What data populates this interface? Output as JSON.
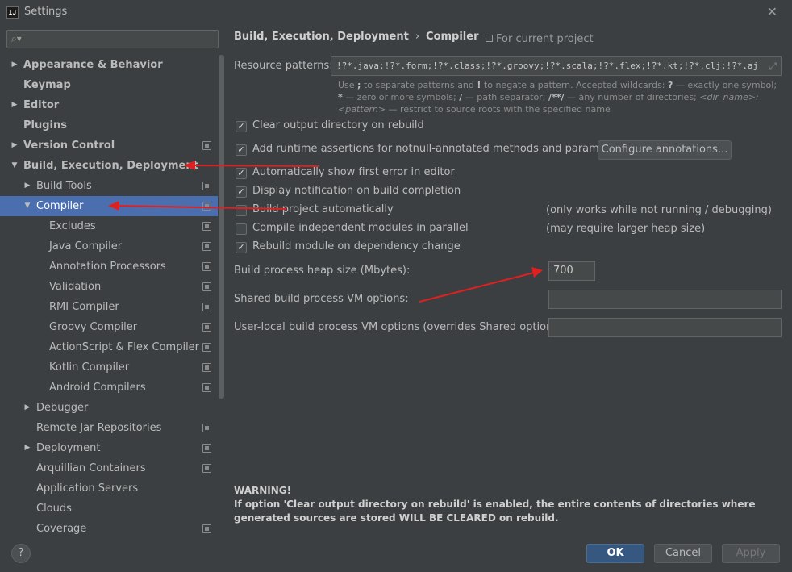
{
  "window": {
    "title": "Settings",
    "app_icon_text": "IJ"
  },
  "search": {
    "placeholder": ""
  },
  "sidebar": {
    "items": [
      {
        "label": "Appearance & Behavior",
        "level": 0,
        "arrow": "right",
        "bold": true,
        "project": false,
        "selected": false
      },
      {
        "label": "Keymap",
        "level": 0,
        "arrow": "none",
        "bold": true,
        "project": false,
        "selected": false
      },
      {
        "label": "Editor",
        "level": 0,
        "arrow": "right",
        "bold": true,
        "project": false,
        "selected": false
      },
      {
        "label": "Plugins",
        "level": 0,
        "arrow": "none",
        "bold": true,
        "project": false,
        "selected": false
      },
      {
        "label": "Version Control",
        "level": 0,
        "arrow": "right",
        "bold": true,
        "project": true,
        "selected": false
      },
      {
        "label": "Build, Execution, Deployment",
        "level": 0,
        "arrow": "down",
        "bold": true,
        "project": false,
        "selected": false
      },
      {
        "label": "Build Tools",
        "level": 1,
        "arrow": "right",
        "bold": false,
        "project": true,
        "selected": false
      },
      {
        "label": "Compiler",
        "level": 1,
        "arrow": "down",
        "bold": false,
        "project": true,
        "selected": true
      },
      {
        "label": "Excludes",
        "level": 2,
        "arrow": "none",
        "bold": false,
        "project": true,
        "selected": false
      },
      {
        "label": "Java Compiler",
        "level": 2,
        "arrow": "none",
        "bold": false,
        "project": true,
        "selected": false
      },
      {
        "label": "Annotation Processors",
        "level": 2,
        "arrow": "none",
        "bold": false,
        "project": true,
        "selected": false
      },
      {
        "label": "Validation",
        "level": 2,
        "arrow": "none",
        "bold": false,
        "project": true,
        "selected": false
      },
      {
        "label": "RMI Compiler",
        "level": 2,
        "arrow": "none",
        "bold": false,
        "project": true,
        "selected": false
      },
      {
        "label": "Groovy Compiler",
        "level": 2,
        "arrow": "none",
        "bold": false,
        "project": true,
        "selected": false
      },
      {
        "label": "ActionScript & Flex Compiler",
        "level": 2,
        "arrow": "none",
        "bold": false,
        "project": true,
        "selected": false
      },
      {
        "label": "Kotlin Compiler",
        "level": 2,
        "arrow": "none",
        "bold": false,
        "project": true,
        "selected": false
      },
      {
        "label": "Android Compilers",
        "level": 2,
        "arrow": "none",
        "bold": false,
        "project": true,
        "selected": false
      },
      {
        "label": "Debugger",
        "level": 1,
        "arrow": "right",
        "bold": false,
        "project": false,
        "selected": false
      },
      {
        "label": "Remote Jar Repositories",
        "level": 1,
        "arrow": "none",
        "bold": false,
        "project": true,
        "selected": false
      },
      {
        "label": "Deployment",
        "level": 1,
        "arrow": "right",
        "bold": false,
        "project": true,
        "selected": false
      },
      {
        "label": "Arquillian Containers",
        "level": 1,
        "arrow": "none",
        "bold": false,
        "project": true,
        "selected": false
      },
      {
        "label": "Application Servers",
        "level": 1,
        "arrow": "none",
        "bold": false,
        "project": false,
        "selected": false
      },
      {
        "label": "Clouds",
        "level": 1,
        "arrow": "none",
        "bold": false,
        "project": false,
        "selected": false
      },
      {
        "label": "Coverage",
        "level": 1,
        "arrow": "none",
        "bold": false,
        "project": true,
        "selected": false
      }
    ]
  },
  "breadcrumb": {
    "parent": "Build, Execution, Deployment",
    "separator": "›",
    "current": "Compiler"
  },
  "for_current_project": "For current project",
  "resource_patterns": {
    "label": "Resource patterns:",
    "value": "!?*.java;!?*.form;!?*.class;!?*.groovy;!?*.scala;!?*.flex;!?*.kt;!?*.clj;!?*.aj",
    "hint_1": "Use ",
    "hint_semicolon": ";",
    "hint_2": " to separate patterns and ",
    "hint_bang": "!",
    "hint_3": " to negate a pattern. Accepted wildcards: ",
    "hint_q": "?",
    "hint_4": " — exactly one symbol; ",
    "hint_star": "*",
    "hint_5": " — zero or more symbols; ",
    "hint_slash": "/",
    "hint_6": " — path separator; ",
    "hint_dstar": "/**/",
    "hint_7": " — any number of directories; ",
    "hint_dir": "<dir_name>:<pattern>",
    "hint_8": " — restrict to source roots with the specified name"
  },
  "options": [
    {
      "label": "Clear output directory on rebuild",
      "checked": true,
      "check_glyph": "✓"
    },
    {
      "label": "Add runtime assertions for notnull-annotated methods and parameters",
      "checked": true,
      "check_glyph": "✓"
    },
    {
      "label": "Automatically show first error in editor",
      "checked": true,
      "check_glyph": "✓"
    },
    {
      "label": "Display notification on build completion",
      "checked": true,
      "check_glyph": "✓"
    },
    {
      "label": "Build project automatically",
      "checked": false,
      "check_glyph": ""
    },
    {
      "label": "Compile independent modules in parallel",
      "checked": false,
      "check_glyph": ""
    },
    {
      "label": "Rebuild module on dependency change",
      "checked": true,
      "check_glyph": "✓"
    }
  ],
  "configure_annotations_label": "Configure annotations...",
  "notes": {
    "build_auto": "(only works while not running / debugging)",
    "parallel": "(may require larger heap size)"
  },
  "heap": {
    "label": "Build process heap size (Mbytes):",
    "value": "700"
  },
  "shared_vm": {
    "label": "Shared build process VM options:",
    "value": ""
  },
  "user_vm": {
    "label": "User-local build process VM options (overrides Shared options):",
    "value": ""
  },
  "warning": {
    "title": "WARNING!",
    "body": "If option 'Clear output directory on rebuild' is enabled, the entire contents of directories where generated sources are stored WILL BE CLEARED on rebuild."
  },
  "footer": {
    "help": "?",
    "ok": "OK",
    "cancel": "Cancel",
    "apply": "Apply"
  },
  "colors": {
    "background": "#3c3f41",
    "selection": "#4b6eaf",
    "primary_button": "#365880",
    "annotation_arrow": "#e02020"
  }
}
